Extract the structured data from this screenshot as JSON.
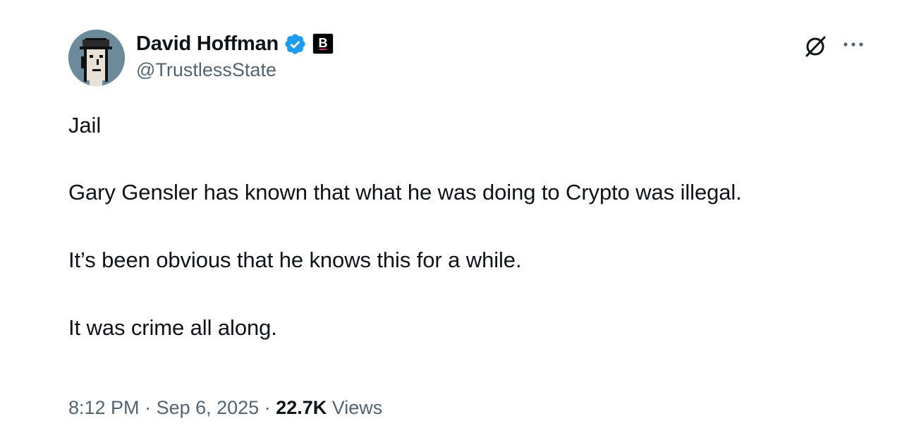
{
  "author": {
    "display_name": "David Hoffman",
    "handle": "@TrustlessState",
    "affiliate_badge_letter": "B"
  },
  "tweet": {
    "lines": [
      "Jail",
      "Gary Gensler has known that what he was doing to Crypto was illegal.",
      "It’s been obvious that he knows this for a while.",
      "It was crime all along."
    ]
  },
  "meta": {
    "time": "8:12 PM",
    "separator": " · ",
    "date": "Sep 6, 2025",
    "views_count": "22.7K",
    "views_label": " Views"
  },
  "icons": {
    "verified": "verified-badge-icon",
    "grok": "grok-icon",
    "more": "more-icon"
  },
  "colors": {
    "verified_blue": "#1d9bf0",
    "secondary_text": "#536471",
    "primary_text": "#0f1419"
  }
}
